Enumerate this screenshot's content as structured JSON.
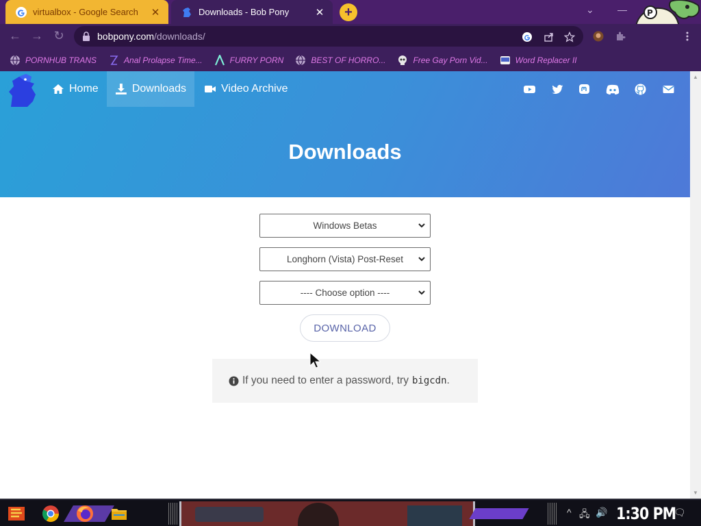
{
  "browser": {
    "tabs": [
      {
        "title": "virtualbox - Google Search",
        "close": "✕",
        "favicon": "google-icon"
      },
      {
        "title": "Downloads - Bob Pony",
        "close": "✕",
        "favicon": "bob-pony-icon"
      }
    ],
    "new_tab": "+",
    "window_controls": {
      "dropdown": "⌄",
      "minimize": "—"
    },
    "nav": {
      "back": "←",
      "forward": "→",
      "reload": "↻"
    },
    "url": {
      "host": "bobpony.com",
      "path": "/downloads/"
    },
    "bookmarks": [
      {
        "label": "PORNHUB TRANS",
        "icon": "globe-icon"
      },
      {
        "label": "Anal Prolapse Time...",
        "icon": "bracket-icon"
      },
      {
        "label": "FURRY PORN",
        "icon": "arrow-logo-icon"
      },
      {
        "label": "BEST OF HORRO...",
        "icon": "globe-icon"
      },
      {
        "label": "Free Gay Porn Vid...",
        "icon": "skull-icon"
      },
      {
        "label": "Word Replacer II",
        "icon": "wr-icon"
      }
    ],
    "colors": {
      "frame": "#3d1f5c",
      "tab_inactive": "#f2b632",
      "bookmark_text": "#e07ae8"
    }
  },
  "site": {
    "nav": [
      {
        "label": "Home",
        "icon": "home-icon"
      },
      {
        "label": "Downloads",
        "icon": "download-icon"
      },
      {
        "label": "Video Archive",
        "icon": "video-camera-icon"
      }
    ],
    "social_icons": [
      "youtube-icon",
      "twitter-icon",
      "mastodon-icon",
      "discord-icon",
      "github-icon",
      "email-icon"
    ],
    "title": "Downloads",
    "selects": [
      {
        "value": "Windows Betas"
      },
      {
        "value": "Longhorn (Vista) Post-Reset"
      },
      {
        "value": "---- Choose option ----"
      }
    ],
    "download_label": "DOWNLOAD",
    "notice": {
      "text": "If you need to enter a password, try",
      "code": "bigcdn",
      "suffix": "."
    },
    "colors": {
      "hero_start": "#2aa0d8",
      "hero_end": "#4e79d8",
      "button_text": "#5863a8"
    }
  },
  "taskbar": {
    "apps": [
      "start-icon",
      "chrome-icon",
      "firefox-icon",
      "folder-icon"
    ],
    "tray": {
      "chevron": "^",
      "network": "🖧",
      "volume": "🔊",
      "notifications": "🗨"
    },
    "clock": "1:30 PM"
  }
}
